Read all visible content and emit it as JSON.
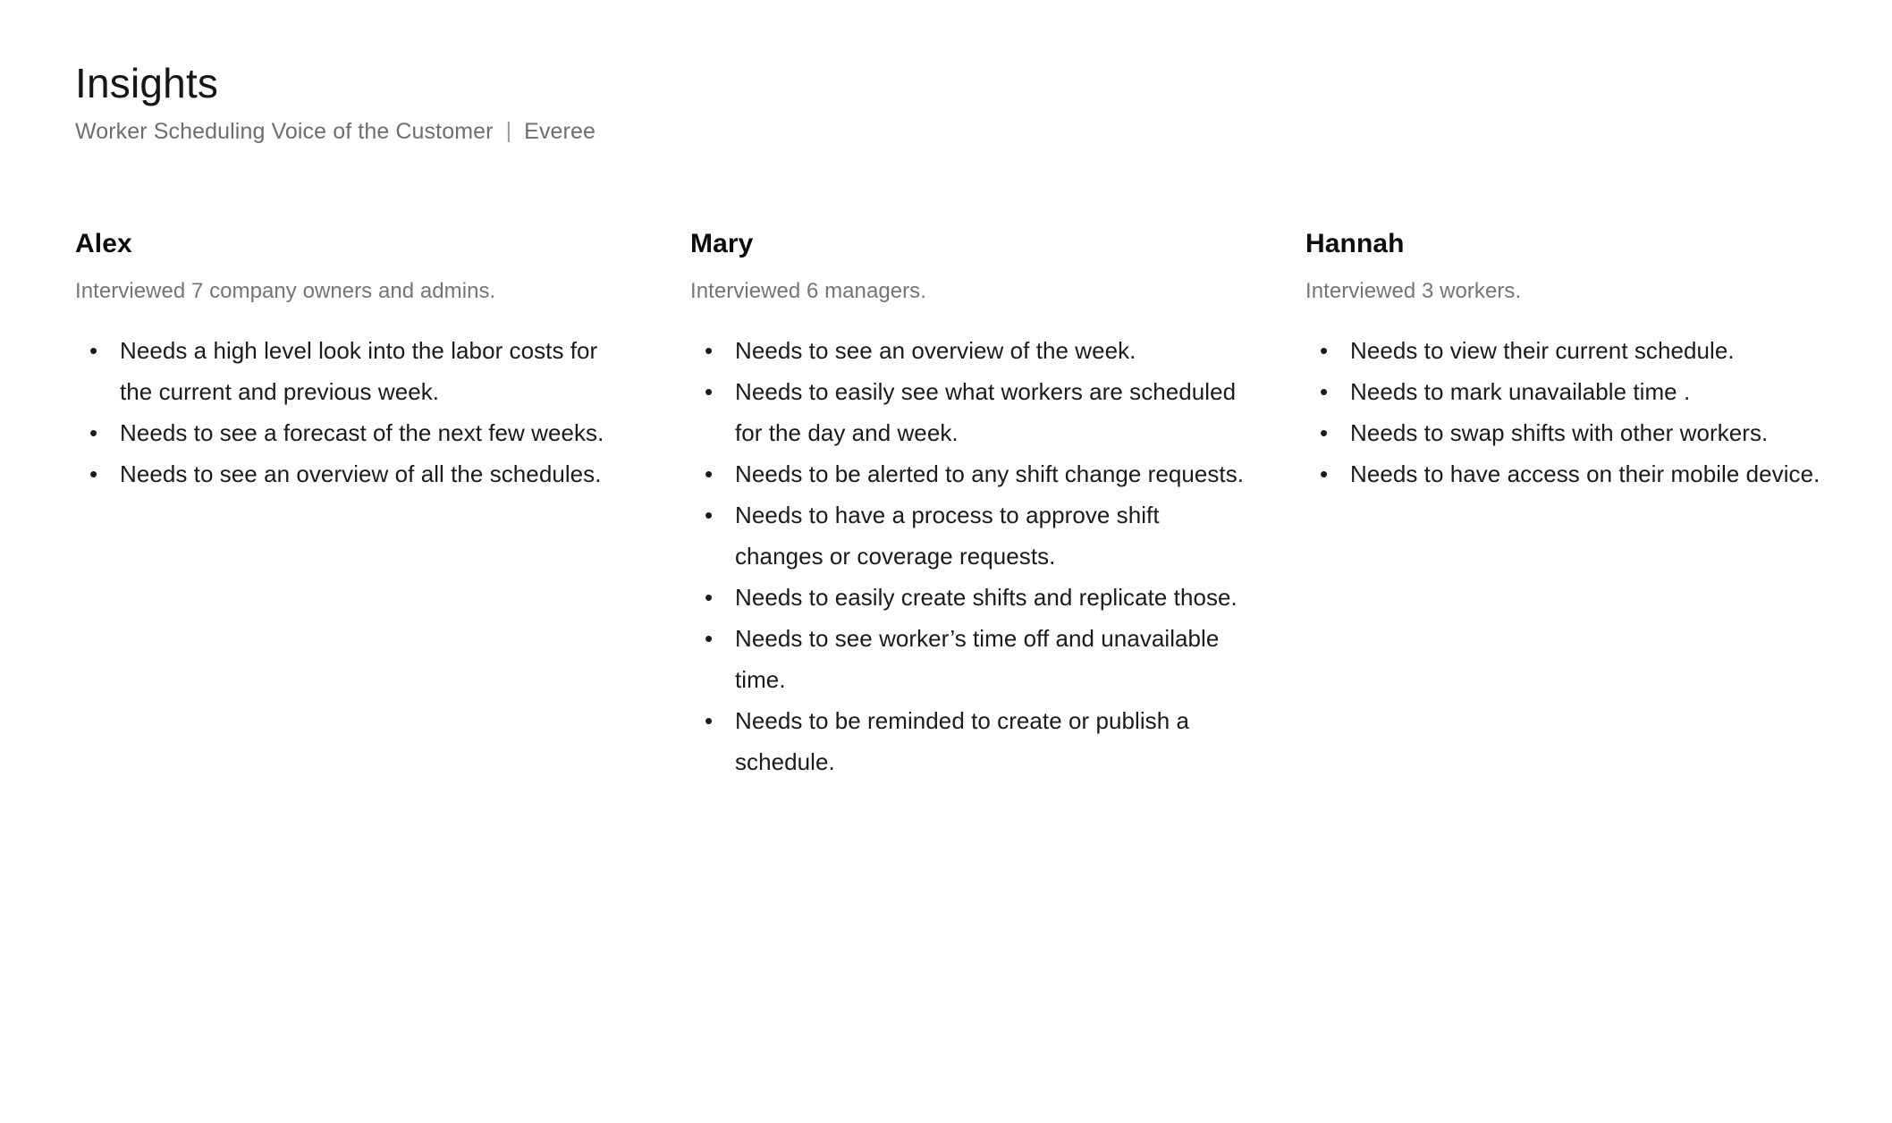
{
  "header": {
    "title": "Insights",
    "subtitle_left": "Worker Scheduling Voice of the Customer",
    "subtitle_separator": "|",
    "subtitle_right": "Everee"
  },
  "colors": {
    "background": "#ffffff",
    "title": "#161616",
    "subtitle": "#6e6e6e",
    "persona_name": "#0d0d0d",
    "persona_meta": "#757575",
    "body_text": "#1b1b1b"
  },
  "columns": [
    {
      "name": "Alex",
      "meta": "Interviewed 7 company owners and admins.",
      "needs": [
        "Needs a high level look into the labor costs for the current and previous week.",
        "Needs to see a forecast of the next few weeks.",
        "Needs to see an overview of all the schedules."
      ]
    },
    {
      "name": "Mary",
      "meta": "Interviewed 6 managers.",
      "needs": [
        "Needs to see an overview of the week.",
        "Needs to easily see what workers are scheduled for the day and week.",
        "Needs to be alerted to any shift change requests.",
        "Needs to have a process to approve shift changes or coverage requests.",
        "Needs to easily create shifts and replicate those.",
        "Needs to see worker’s time off and unavailable time.",
        "Needs to be reminded to create or publish a schedule."
      ]
    },
    {
      "name": "Hannah",
      "meta": "Interviewed 3 workers.",
      "needs": [
        "Needs to view their current schedule.",
        "Needs to mark unavailable time .",
        "Needs to swap shifts with other workers.",
        "Needs to have access on their mobile device."
      ]
    }
  ],
  "bullet_glyph": "•"
}
